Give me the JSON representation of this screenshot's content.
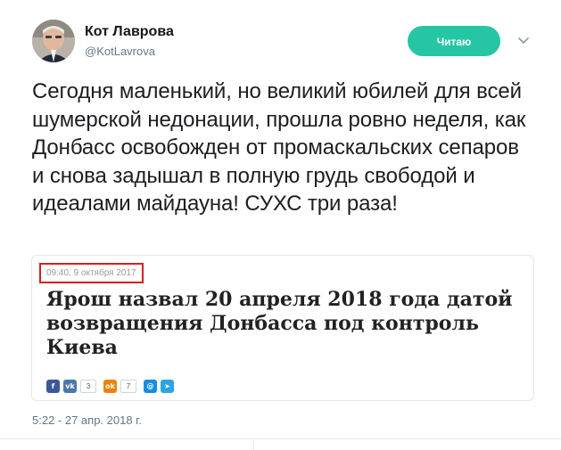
{
  "author": {
    "name": "Кот Лаврова",
    "handle": "@KotLavrova"
  },
  "follow_button": {
    "label": "Читаю",
    "color": "#26c6a4"
  },
  "icons": {
    "menu": "chevron-down-icon",
    "avatar": "avatar-photo"
  },
  "tweet": {
    "text": "Сегодня маленький, но великий юбилей для всей шумерской недонации, прошла ровно неделя, как Донбасс освобожден от промаскальских сепаров и снова задышал в полную грудь свободой и идеалами майдауна! СУХС три раза!",
    "timestamp": "5:22 - 27 апр. 2018 г."
  },
  "card": {
    "date": "09:40, 9 октября 2017",
    "headline": "Ярош назвал 20 апреля 2018 года датой возвращения Донбасса под контроль Киева",
    "highlight_color": "#d61f1f",
    "share_buttons": [
      {
        "icon": "facebook-icon",
        "glyph": "f",
        "color": "#3b5998",
        "count": ""
      },
      {
        "icon": "vk-icon",
        "glyph": "vk",
        "color": "#4a76a8",
        "count": "3"
      },
      {
        "icon": "odnoklassniki-icon",
        "glyph": "ok",
        "color": "#ee8208",
        "count": "7"
      },
      {
        "icon": "mail-ru-icon",
        "glyph": "@",
        "color": "#168de2",
        "count": ""
      },
      {
        "icon": "telegram-icon",
        "glyph": "➤",
        "color": "#2ca5e0",
        "count": ""
      }
    ]
  }
}
